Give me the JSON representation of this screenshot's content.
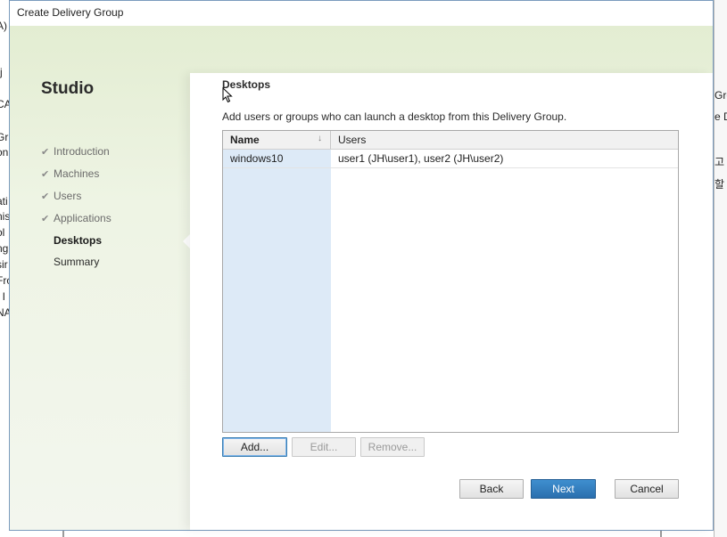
{
  "window": {
    "title": "Create Delivery Group"
  },
  "sidebar": {
    "brand": "Studio",
    "steps": [
      {
        "label": "Introduction",
        "check": "✔",
        "state": "done"
      },
      {
        "label": "Machines",
        "check": "✔",
        "state": "done"
      },
      {
        "label": "Users",
        "check": "✔",
        "state": "done"
      },
      {
        "label": "Applications",
        "check": "✔",
        "state": "done"
      },
      {
        "label": "Desktops",
        "check": "",
        "state": "active"
      },
      {
        "label": "Summary",
        "check": "",
        "state": "pending"
      }
    ]
  },
  "page": {
    "heading": "Desktops",
    "description": "Add users or groups who can launch a desktop from this Delivery Group."
  },
  "grid": {
    "columns": [
      "Name",
      "Users"
    ],
    "rows": [
      {
        "name": "windows10",
        "users": "user1 (JH\\user1), user2 (JH\\user2)"
      }
    ]
  },
  "actions": {
    "add": "Add...",
    "edit": "Edit...",
    "remove": "Remove..."
  },
  "nav": {
    "back": "Back",
    "next": "Next",
    "cancel": "Cancel"
  },
  "background": {
    "left_fragments": [
      "A)",
      "(j",
      "CA",
      "Gr",
      "on",
      "ati",
      "nis",
      "ol",
      "ng",
      "sir",
      "Fro",
      "/ I",
      "NA"
    ],
    "right_fragments": [
      "Gro",
      "e Dr",
      "고",
      "할"
    ]
  },
  "colors": {
    "accent": "#2a6fae",
    "gradient": "#e3edd2",
    "grid_name_column": "#ddeaf7"
  }
}
